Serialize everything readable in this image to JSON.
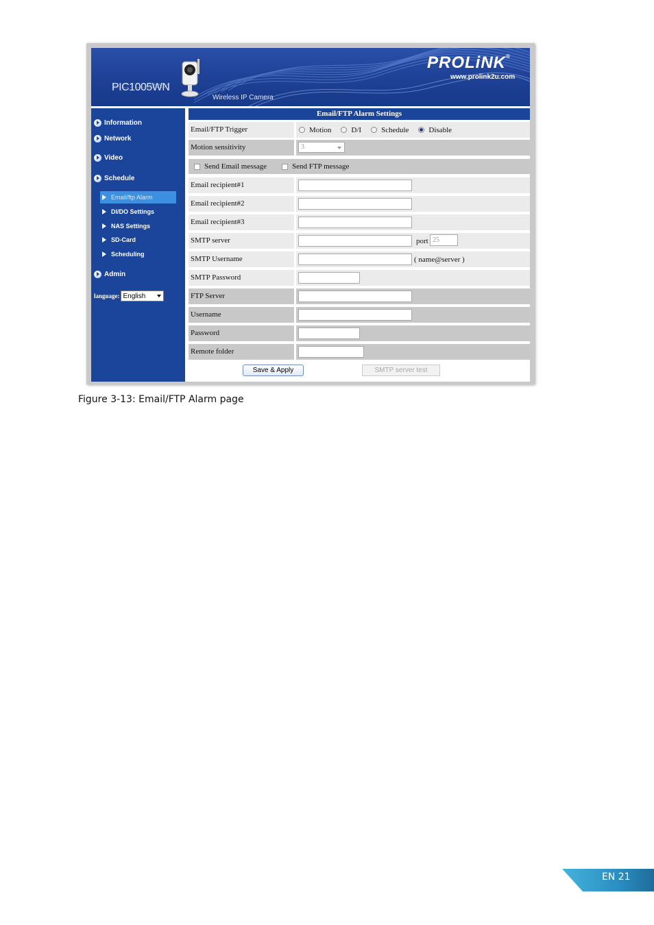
{
  "banner": {
    "model": "PIC1005WN",
    "tagline": "Wireless IP Camera",
    "brand": "PROLiNK",
    "brand_mark": "®",
    "url": "www.prolink2u.com"
  },
  "sidebar": {
    "main_items": [
      {
        "label": "Information"
      },
      {
        "label": "Network"
      },
      {
        "label": "Video"
      },
      {
        "label": "Schedule"
      },
      {
        "label": "Admin"
      }
    ],
    "sub_items": [
      {
        "label": "Email/ftp Alarm",
        "active": true
      },
      {
        "label": "DI/DO Settings"
      },
      {
        "label": "NAS Settings"
      },
      {
        "label": "SD-Card"
      },
      {
        "label": "Scheduling"
      }
    ],
    "language_label": "language:",
    "language_value": "English"
  },
  "form": {
    "title": "Email/FTP Alarm Settings",
    "trigger_label": "Email/FTP Trigger",
    "trigger_options": [
      {
        "label": "Motion",
        "checked": false
      },
      {
        "label": "D/I",
        "checked": false
      },
      {
        "label": "Schedule",
        "checked": false
      },
      {
        "label": "Disable",
        "checked": true
      }
    ],
    "sensitivity_label": "Motion sensitivity",
    "sensitivity_value": "3",
    "send_email_label": "Send Email message",
    "send_ftp_label": "Send FTP message",
    "recipient1_label": "Email recipient#1",
    "recipient2_label": "Email recipient#2",
    "recipient3_label": "Email recipient#3",
    "smtp_server_label": "SMTP server",
    "port_label": "port",
    "port_value": "25",
    "smtp_username_label": "SMTP Username",
    "smtp_username_hint": "( name@server )",
    "smtp_password_label": "SMTP Password",
    "ftp_server_label": "FTP Server",
    "username_label": "Username",
    "password_label": "Password",
    "remote_folder_label": "Remote folder",
    "save_button": "Save & Apply",
    "smtp_test_button": "SMTP server test"
  },
  "caption": "Figure 3-13: Email/FTP Alarm page",
  "page_number": "EN 21",
  "colors": {
    "nav_blue": "#1b449b",
    "active_sub": "#3d8fe0",
    "page_tab": "#2e9cc8"
  }
}
